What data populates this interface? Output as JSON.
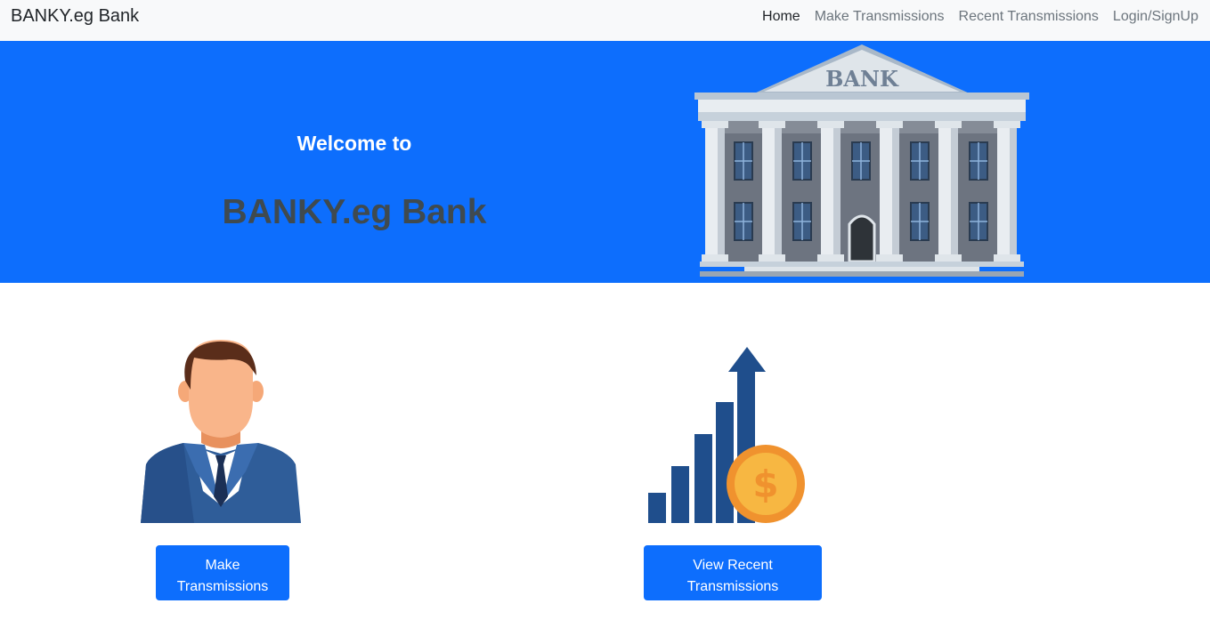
{
  "navbar": {
    "brand": "BANKY.eg Bank",
    "links": [
      {
        "label": "Home",
        "active": true
      },
      {
        "label": "Make Transmissions",
        "active": false
      },
      {
        "label": "Recent Transmissions",
        "active": false
      },
      {
        "label": "Login/SignUp",
        "active": false
      }
    ]
  },
  "hero": {
    "welcome": "Welcome to",
    "title": "BANKY.eg Bank",
    "building_sign": "BANK",
    "background_color": "#0d6efd"
  },
  "cards": [
    {
      "icon": "businessman-icon",
      "button_line1": "Make",
      "button_line2": "Transmissions"
    },
    {
      "icon": "growth-chart-dollar-icon",
      "button_line1": "View Recent",
      "button_line2": "Transmissions"
    }
  ],
  "colors": {
    "primary": "#0d6efd",
    "navbar_bg": "#f8f9fa",
    "title_dark": "#3f4a4f"
  }
}
